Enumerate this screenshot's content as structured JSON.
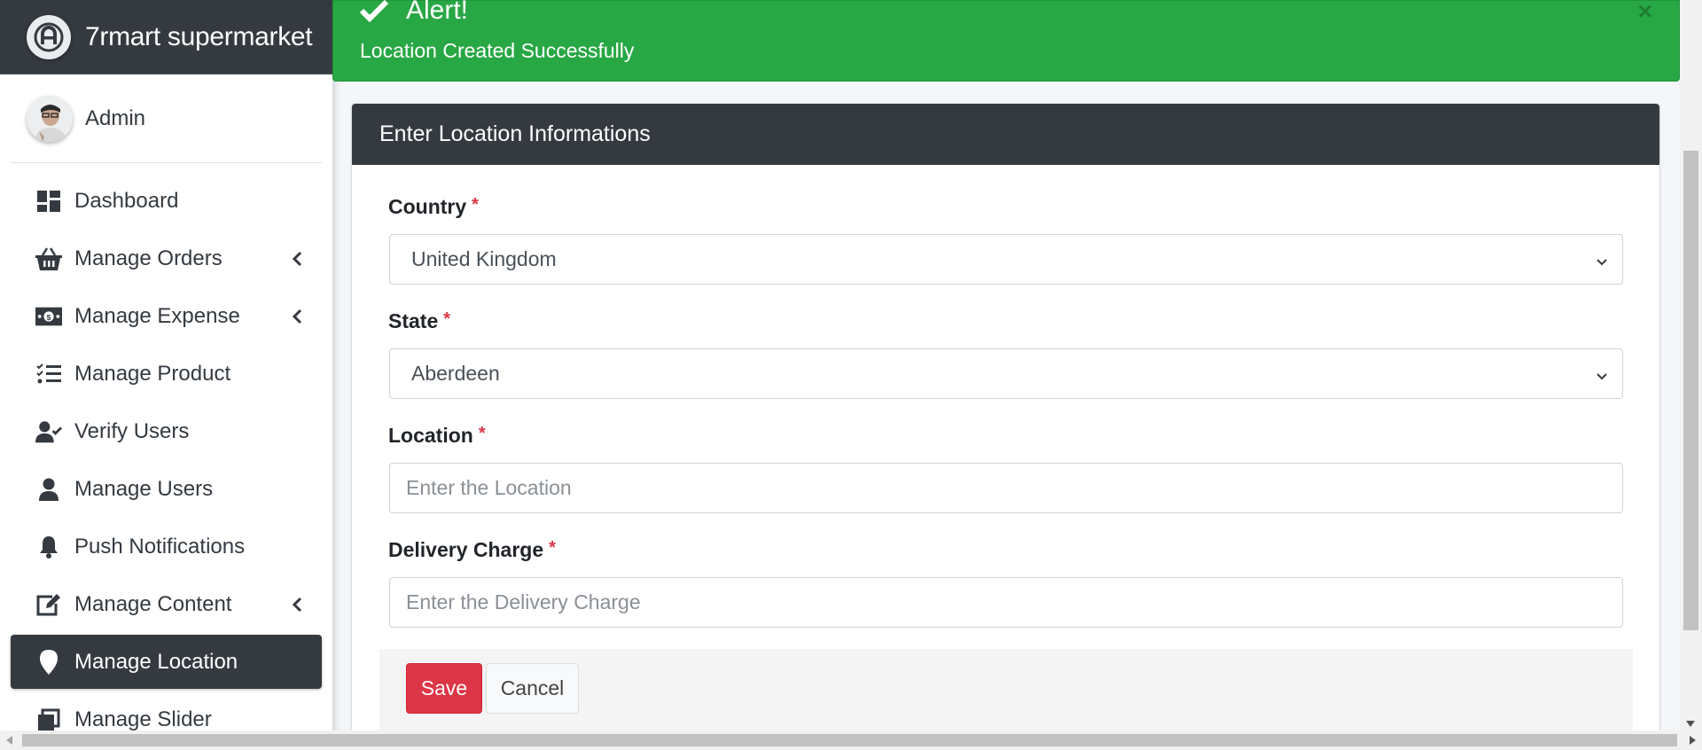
{
  "brand": {
    "name": "7rmart supermarket"
  },
  "user": {
    "name": "Admin"
  },
  "sidebar": {
    "items": [
      {
        "label": "Dashboard",
        "icon": "dashboard-icon"
      },
      {
        "label": "Manage Orders",
        "icon": "basket-icon",
        "has_submenu": true
      },
      {
        "label": "Manage Expense",
        "icon": "money-bill-icon",
        "has_submenu": true
      },
      {
        "label": "Manage Product",
        "icon": "tasks-list-icon"
      },
      {
        "label": "Verify Users",
        "icon": "user-check-icon"
      },
      {
        "label": "Manage Users",
        "icon": "user-icon"
      },
      {
        "label": "Push Notifications",
        "icon": "bell-icon"
      },
      {
        "label": "Manage Content",
        "icon": "edit-icon",
        "has_submenu": true
      },
      {
        "label": "Manage Location",
        "icon": "map-marker-icon",
        "active": true
      },
      {
        "label": "Manage Slider",
        "icon": "slider-icon"
      }
    ]
  },
  "alert": {
    "title": "Alert!",
    "message": "Location Created Successfully",
    "close": "×",
    "color": "#28a745"
  },
  "form": {
    "header": "Enter Location Informations",
    "required_mark": "*",
    "country": {
      "label": "Country",
      "value": "United Kingdom"
    },
    "state": {
      "label": "State",
      "value": "Aberdeen"
    },
    "location": {
      "label": "Location",
      "placeholder": "Enter the Location"
    },
    "delivery_charge": {
      "label": "Delivery Charge",
      "placeholder": "Enter the Delivery Charge"
    },
    "save_label": "Save",
    "cancel_label": "Cancel"
  },
  "colors": {
    "dark": "#343a40",
    "danger": "#dc3545",
    "success": "#28a745"
  }
}
